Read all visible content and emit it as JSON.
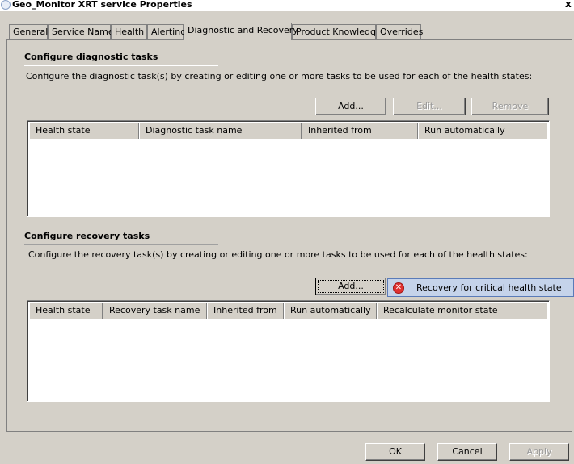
{
  "window": {
    "title": "Geo_Monitor XRT service Properties",
    "close_glyph": "x"
  },
  "tabs": [
    {
      "label": "General"
    },
    {
      "label": "Service Name"
    },
    {
      "label": "Health"
    },
    {
      "label": "Alerting"
    },
    {
      "label": "Diagnostic and Recovery",
      "active": true
    },
    {
      "label": "Product Knowledge"
    },
    {
      "label": "Overrides"
    }
  ],
  "diagnostic": {
    "heading": "Configure diagnostic tasks",
    "description": "Configure the diagnostic task(s) by creating or editing one or more tasks to be used for each of the health states:",
    "buttons": {
      "add": "Add...",
      "edit": "Edit...",
      "remove": "Remove"
    },
    "columns": [
      "Health state",
      "Diagnostic task name",
      "Inherited from",
      "Run automatically"
    ],
    "rows": []
  },
  "recovery": {
    "heading": "Configure recovery tasks",
    "description": "Configure the recovery task(s) by creating or editing one or more tasks to be used for each of the health states:",
    "buttons": {
      "add": "Add..."
    },
    "columns": [
      "Health state",
      "Recovery task name",
      "Inherited from",
      "Run automatically",
      "Recalculate monitor state"
    ],
    "rows": []
  },
  "add_menu": {
    "item_label": "Recovery for critical health state",
    "icon": "error-icon"
  },
  "footer": {
    "ok": "OK",
    "cancel": "Cancel",
    "apply": "Apply"
  },
  "colors": {
    "menu_highlight": "#c5d3ea",
    "error": "#e03030",
    "window_bg": "#d4d0c8"
  }
}
